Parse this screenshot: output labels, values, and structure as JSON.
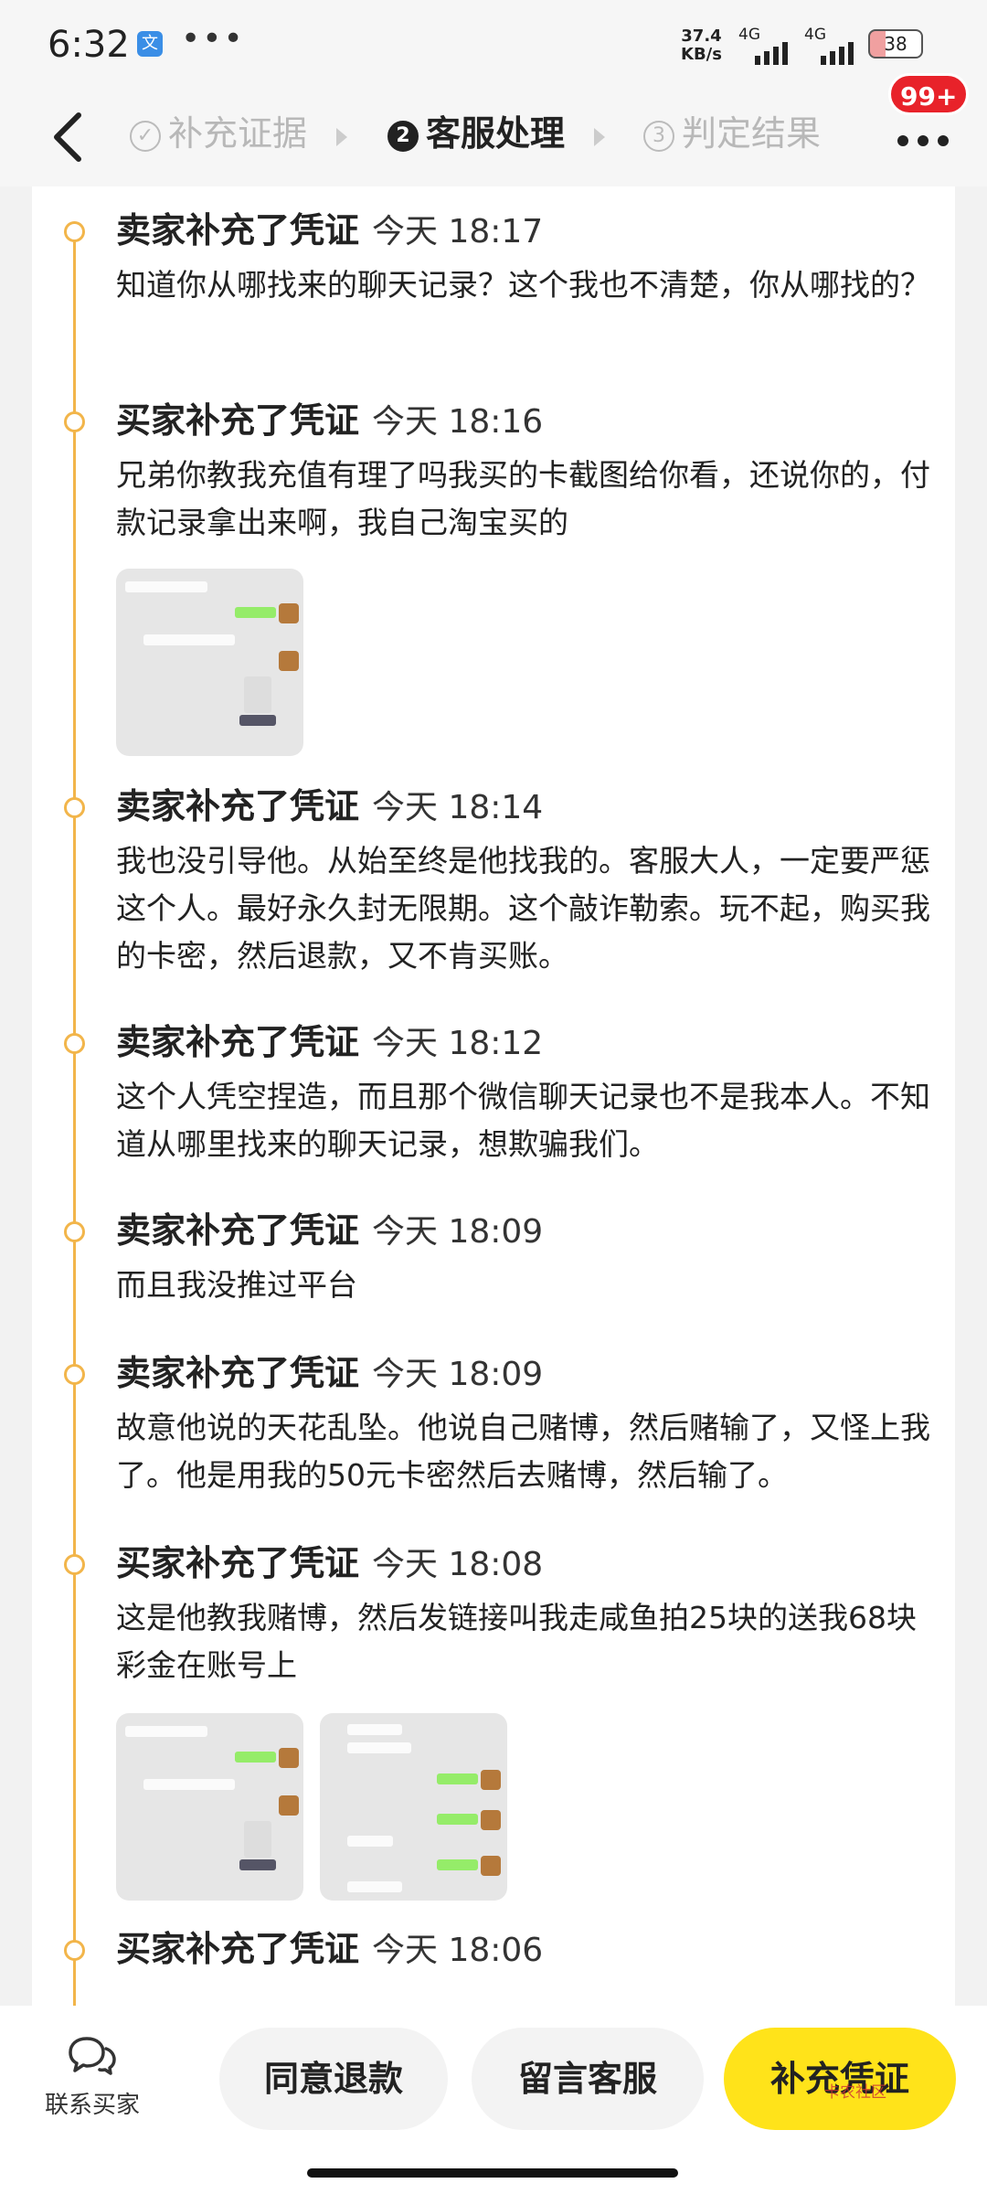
{
  "status_bar": {
    "time": "6:32",
    "app_icon_glyph": "文",
    "more": "•••",
    "speed_value": "37.4",
    "speed_unit": "KB/s",
    "sim1": "4G",
    "sim2": "4G",
    "battery": "38"
  },
  "nav": {
    "steps": [
      {
        "num": "✓",
        "label": "补充证据"
      },
      {
        "num": "2",
        "label": "客服处理"
      },
      {
        "num": "3",
        "label": "判定结果"
      }
    ],
    "badge": "99+"
  },
  "timeline": [
    {
      "title": "卖家补充了凭证",
      "time": "今天 18:17",
      "text": "知道你从哪找来的聊天记录？这个我也不清楚，你从哪找的？"
    },
    {
      "title": "买家补充了凭证",
      "time": "今天 18:16",
      "text": "兄弟你教我充值有理了吗我买的卡截图给你看，还说你的，付款记录拿出来啊，我自己淘宝买的",
      "images": 1
    },
    {
      "title": "卖家补充了凭证",
      "time": "今天 18:14",
      "text": "我也没引导他。从始至终是他找我的。客服大人，一定要严惩这个人。最好永久封无限期。这个敲诈勒索。玩不起，购买我的卡密，然后退款，又不肯买账。"
    },
    {
      "title": "卖家补充了凭证",
      "time": "今天 18:12",
      "text": "这个人凭空捏造，而且那个微信聊天记录也不是我本人。不知道从哪里找来的聊天记录，想欺骗我们。"
    },
    {
      "title": "卖家补充了凭证",
      "time": "今天 18:09",
      "text": "而且我没推过平台"
    },
    {
      "title": "卖家补充了凭证",
      "time": "今天 18:09",
      "text": "故意他说的天花乱坠。他说自己赌博，然后赌输了，又怪上我了。他是用我的50元卡密然后去赌博，然后输了。"
    },
    {
      "title": "买家补充了凭证",
      "time": "今天 18:08",
      "text": "这是他教我赌博，然后发链接叫我走咸鱼拍25块的送我68块彩金在账号上",
      "images": 2
    },
    {
      "title": "买家补充了凭证",
      "time": "今天 18:06",
      "text": ""
    }
  ],
  "bottom": {
    "contact_label": "联系买家",
    "agree_refund": "同意退款",
    "message_cs": "留言客服",
    "add_evidence": "补充凭证",
    "watermark": "卡农社区"
  }
}
